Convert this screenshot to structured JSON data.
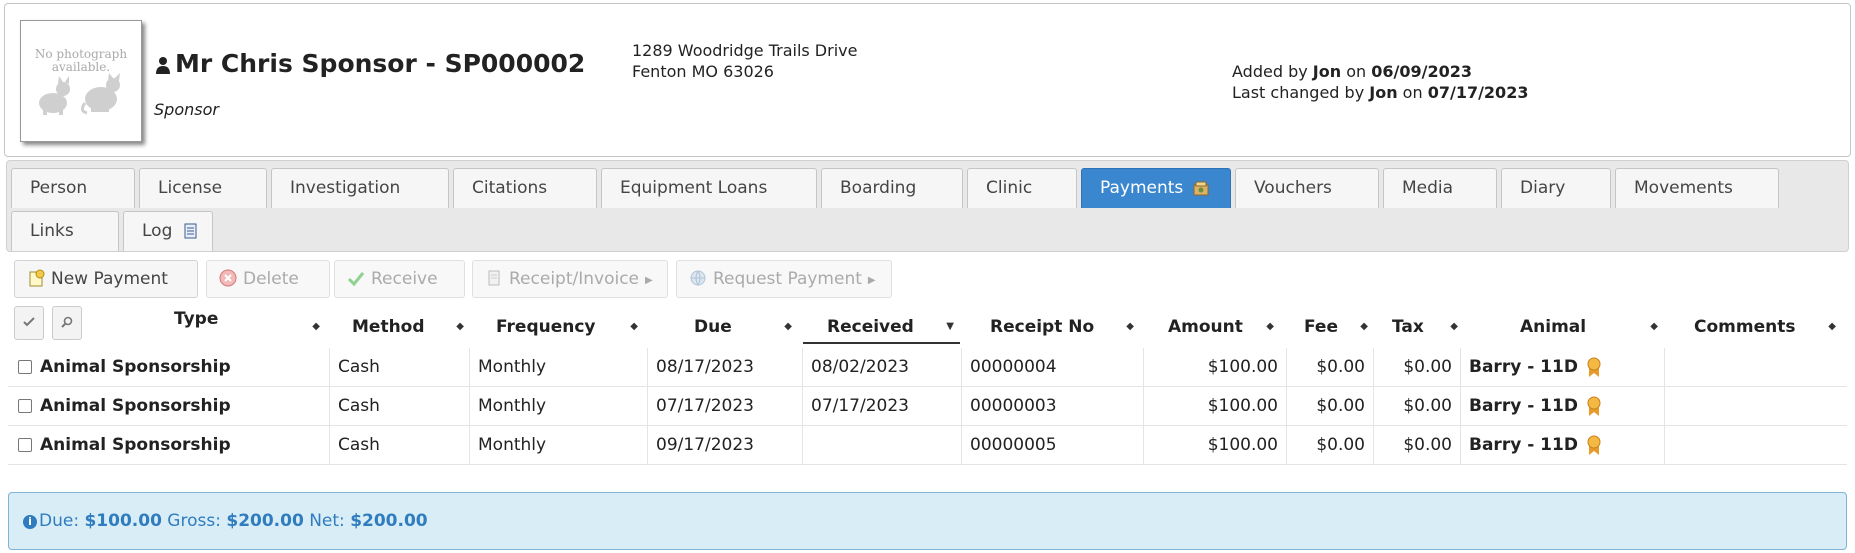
{
  "header": {
    "no_photo_line1": "No photograph",
    "no_photo_line2": "available.",
    "name": "Mr Chris Sponsor - SP000002",
    "role": "Sponsor",
    "address_line1": "1289 Woodridge Trails Drive",
    "address_line2": "Fenton MO 63026",
    "added_by_prefix": "Added by ",
    "added_by_user": "Jon",
    "added_on_word": " on ",
    "added_on_date": "06/09/2023",
    "changed_by_prefix": "Last changed by ",
    "changed_by_user": "Jon",
    "changed_on_word": " on ",
    "changed_on_date": "07/17/2023"
  },
  "tabs": [
    {
      "label": "Person"
    },
    {
      "label": "License"
    },
    {
      "label": "Investigation"
    },
    {
      "label": "Citations"
    },
    {
      "label": "Equipment Loans"
    },
    {
      "label": "Boarding"
    },
    {
      "label": "Clinic"
    },
    {
      "label": "Payments",
      "active": true
    },
    {
      "label": "Vouchers"
    },
    {
      "label": "Media"
    },
    {
      "label": "Diary"
    },
    {
      "label": "Movements"
    },
    {
      "label": "Links"
    },
    {
      "label": "Log"
    }
  ],
  "toolbar": {
    "new_payment": "New Payment",
    "delete": "Delete",
    "receive": "Receive",
    "receipt_invoice": "Receipt/Invoice",
    "request_payment": "Request Payment"
  },
  "table": {
    "headers": {
      "type": "Type",
      "method": "Method",
      "frequency": "Frequency",
      "due": "Due",
      "received": "Received",
      "receipt_no": "Receipt No",
      "amount": "Amount",
      "fee": "Fee",
      "tax": "Tax",
      "animal": "Animal",
      "comments": "Comments"
    },
    "rows": [
      {
        "type": "Animal Sponsorship",
        "method": "Cash",
        "frequency": "Monthly",
        "due": "08/17/2023",
        "received": "08/02/2023",
        "receipt_no": "00000004",
        "amount": "$100.00",
        "fee": "$0.00",
        "tax": "$0.00",
        "animal": "Barry - 11D",
        "comments": ""
      },
      {
        "type": "Animal Sponsorship",
        "method": "Cash",
        "frequency": "Monthly",
        "due": "07/17/2023",
        "received": "07/17/2023",
        "receipt_no": "00000003",
        "amount": "$100.00",
        "fee": "$0.00",
        "tax": "$0.00",
        "animal": "Barry - 11D",
        "comments": ""
      },
      {
        "type": "Animal Sponsorship",
        "method": "Cash",
        "frequency": "Monthly",
        "due": "09/17/2023",
        "received": "",
        "receipt_no": "00000005",
        "amount": "$100.00",
        "fee": "$0.00",
        "tax": "$0.00",
        "animal": "Barry - 11D",
        "comments": ""
      }
    ]
  },
  "summary": {
    "due_label": "Due: ",
    "due_value": "$100.00",
    "gross_label": " Gross: ",
    "gross_value": "$200.00",
    "net_label": " Net: ",
    "net_value": "$200.00"
  },
  "colors": {
    "active_tab": "#3a87cf",
    "summary_bg": "#d9edf7",
    "summary_text": "#2f7cbf"
  }
}
